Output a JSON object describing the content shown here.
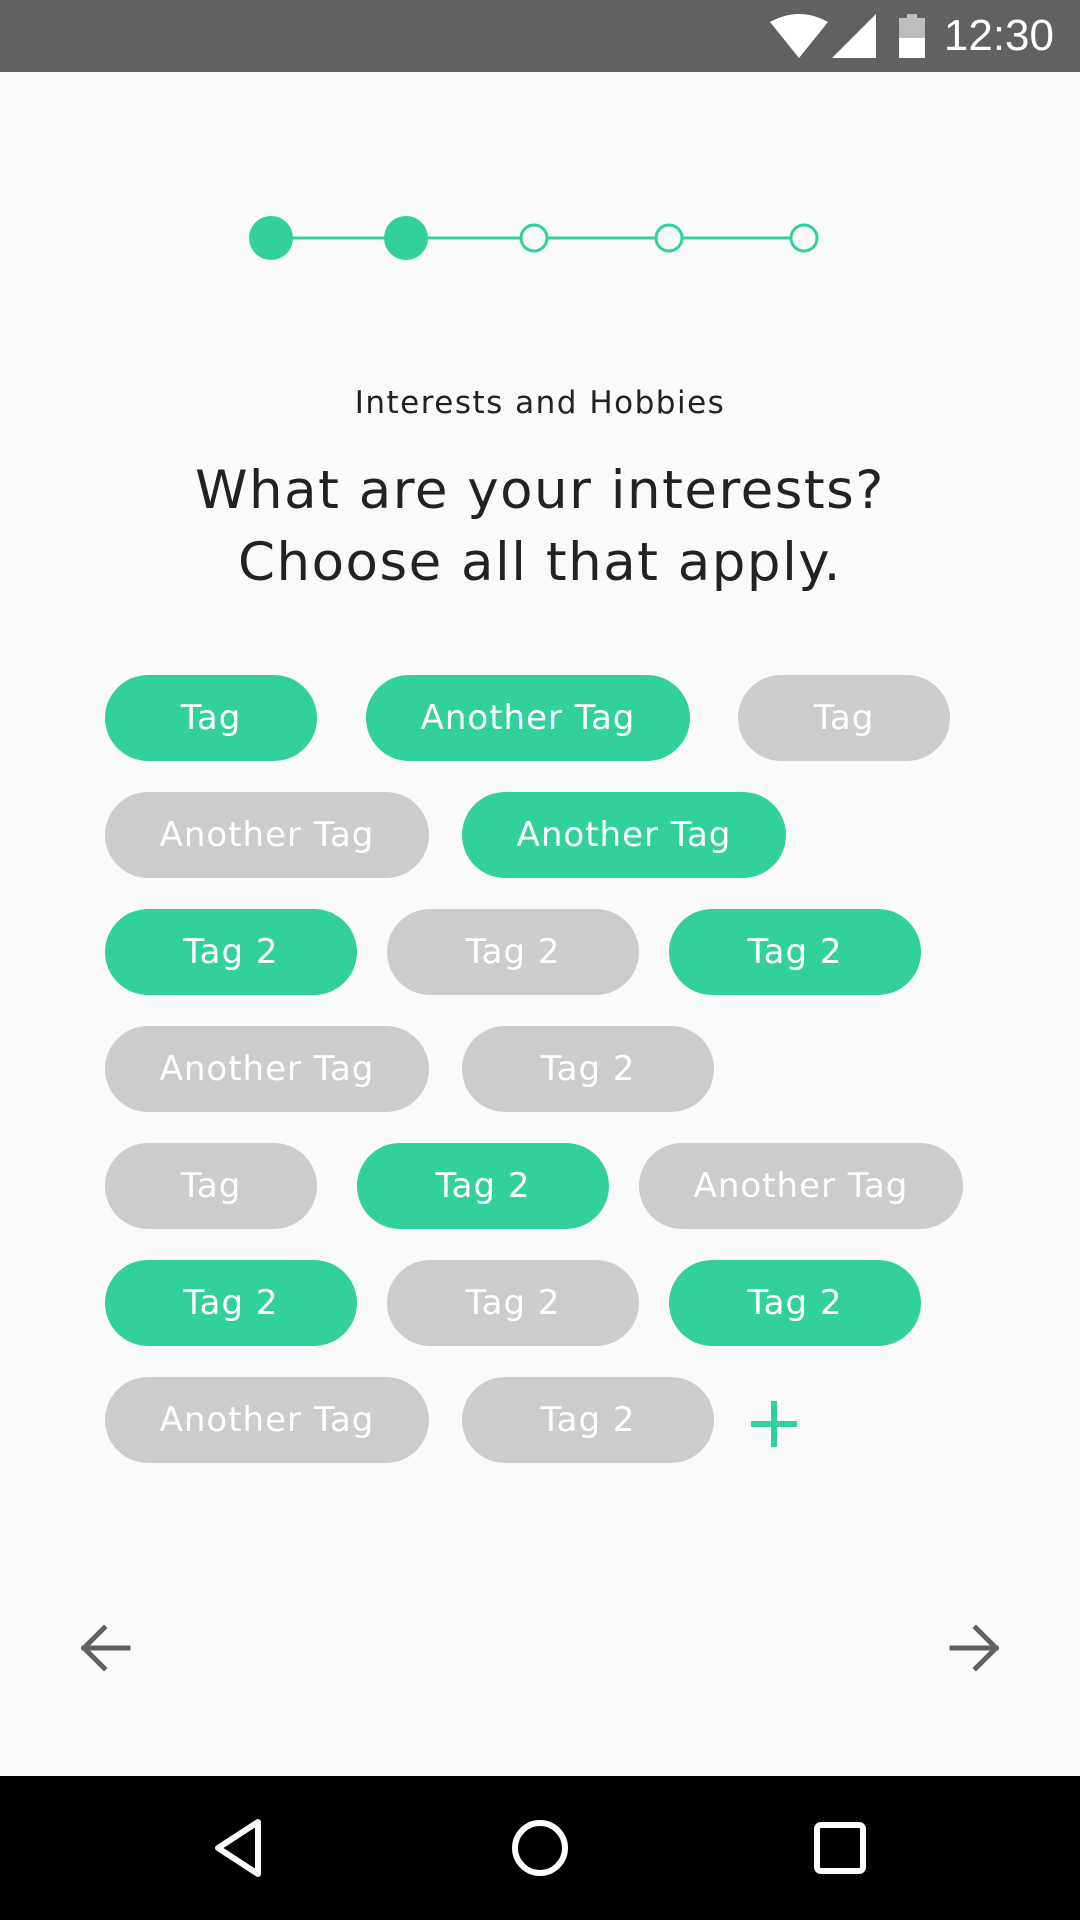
{
  "status_bar": {
    "time": "12:30",
    "icons": [
      "wifi-icon",
      "cellular-signal-icon",
      "battery-icon"
    ]
  },
  "stepper": {
    "total_steps": 5,
    "completed_steps": 2
  },
  "header": {
    "subtitle": "Interests and Hobbies",
    "question_line1": "What are your interests?",
    "question_line2": "Choose all that apply."
  },
  "tags": [
    {
      "label": "Tag",
      "selected": true
    },
    {
      "label": "Another Tag",
      "selected": true
    },
    {
      "label": "Tag",
      "selected": false
    },
    {
      "label": "Another Tag",
      "selected": false
    },
    {
      "label": "Another Tag",
      "selected": true
    },
    {
      "label": "Tag 2",
      "selected": true
    },
    {
      "label": "Tag 2",
      "selected": false
    },
    {
      "label": "Tag 2",
      "selected": true
    },
    {
      "label": "Another Tag",
      "selected": false
    },
    {
      "label": "Tag 2",
      "selected": false
    },
    {
      "label": "Tag",
      "selected": false
    },
    {
      "label": "Tag 2",
      "selected": true
    },
    {
      "label": "Another Tag",
      "selected": false
    },
    {
      "label": "Tag 2",
      "selected": true
    },
    {
      "label": "Tag 2",
      "selected": false
    },
    {
      "label": "Tag 2",
      "selected": true
    },
    {
      "label": "Another Tag",
      "selected": false
    },
    {
      "label": "Tag 2",
      "selected": false
    }
  ],
  "actions": {
    "add_icon": "plus-icon",
    "back_icon": "arrow-left-icon",
    "next_icon": "arrow-right-icon"
  },
  "system_nav": {
    "icons": [
      "back-triangle-icon",
      "home-circle-icon",
      "recents-square-icon"
    ]
  },
  "colors": {
    "accent": "#32d199",
    "tag_unselected": "#cccccc",
    "status_bar": "#616161",
    "background": "#fafafa",
    "text": "#222222"
  }
}
